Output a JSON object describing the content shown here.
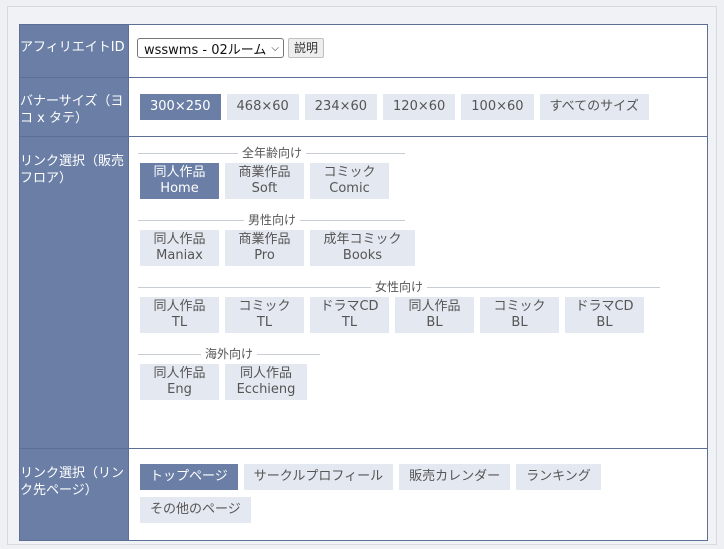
{
  "affiliate": {
    "label": "アフィリエイトID",
    "selected": "wsswms - 02ルーム",
    "help_label": "説明"
  },
  "banner": {
    "label": "バナーサイズ（ヨコ x タテ）",
    "sizes": [
      {
        "label": "300×250",
        "active": true
      },
      {
        "label": "468×60",
        "active": false
      },
      {
        "label": "234×60",
        "active": false
      },
      {
        "label": "120×60",
        "active": false
      },
      {
        "label": "100×60",
        "active": false
      },
      {
        "label": "すべてのサイズ",
        "active": false
      }
    ]
  },
  "floor": {
    "label": "リンク選択（販売フロア）",
    "groups": [
      {
        "title": "全年齢向け",
        "items": [
          {
            "line1": "同人作品",
            "line2": "Home",
            "active": true
          },
          {
            "line1": "商業作品",
            "line2": "Soft",
            "active": false
          },
          {
            "line1": "コミック",
            "line2": "Comic",
            "active": false
          }
        ]
      },
      {
        "title": "男性向け",
        "items": [
          {
            "line1": "同人作品",
            "line2": "Maniax",
            "active": false
          },
          {
            "line1": "商業作品",
            "line2": "Pro",
            "active": false
          },
          {
            "line1": "成年コミック",
            "line2": "Books",
            "active": false
          }
        ]
      },
      {
        "title": "女性向け",
        "items": [
          {
            "line1": "同人作品",
            "line2": "TL",
            "active": false
          },
          {
            "line1": "コミック",
            "line2": "TL",
            "active": false
          },
          {
            "line1": "ドラマCD",
            "line2": "TL",
            "active": false
          },
          {
            "line1": "同人作品",
            "line2": "BL",
            "active": false
          },
          {
            "line1": "コミック",
            "line2": "BL",
            "active": false
          },
          {
            "line1": "ドラマCD",
            "line2": "BL",
            "active": false
          }
        ]
      },
      {
        "title": "海外向け",
        "items": [
          {
            "line1": "同人作品",
            "line2": "Eng",
            "active": false
          },
          {
            "line1": "同人作品",
            "line2": "Ecchieng",
            "active": false
          }
        ]
      }
    ]
  },
  "link_dest": {
    "label": "リンク選択（リンク先ページ）",
    "pages": [
      {
        "label": "トップページ",
        "active": true
      },
      {
        "label": "サークルプロフィール",
        "active": false
      },
      {
        "label": "販売カレンダー",
        "active": false
      },
      {
        "label": "ランキング",
        "active": false
      },
      {
        "label": "その他のページ",
        "active": false
      }
    ]
  },
  "colors": {
    "label_bg": "#6b7fa6",
    "chip_bg": "#e4e8f0",
    "chip_active_bg": "#6b7fa6"
  }
}
